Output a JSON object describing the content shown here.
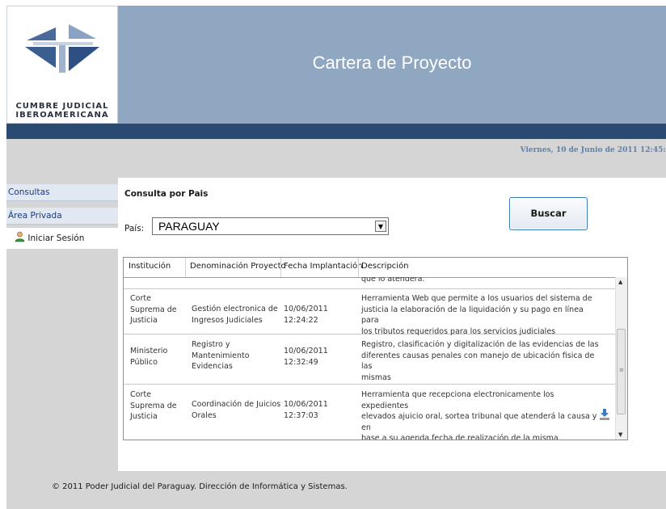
{
  "logo": {
    "line1": "CUMBRE JUDICIAL",
    "line2": "IBEROAMERICANA",
    "icon": "cumbre-judicial-logo-icon"
  },
  "header": {
    "title": "Cartera de Proyecto"
  },
  "date_text": "Viernes, 10 de Junio de 2011 12:45:4",
  "sidebar": {
    "items": [
      {
        "label": "Consultas"
      },
      {
        "label": "Área Privada"
      },
      {
        "label": "Iniciar Sesión",
        "icon": "user-icon"
      }
    ]
  },
  "main": {
    "section_title": "Consulta por Pais",
    "pais_label": "País:",
    "pais_value": "PARAGUAY",
    "buscar_label": "Buscar"
  },
  "grid": {
    "columns": [
      "Institución",
      "Denominación Proyecto",
      "Fecha Implantación",
      "Descripción"
    ],
    "partial_desc": "que lo atenderá.",
    "rows": [
      {
        "institucion": [
          "Corte",
          "Suprema de",
          "Justicia"
        ],
        "denominacion": [
          "Gestión electronica de",
          "Ingresos Judiciales"
        ],
        "fecha": [
          "10/06/2011",
          "12:24:22"
        ],
        "descripcion": [
          "Herramienta Web que permite a los usuarios del sistema de",
          "justicia la elaboración de la liquidación y su pago en línea para",
          "los tributos requeridos para los servicios judiciales"
        ]
      },
      {
        "institucion": [
          "Ministerio",
          "Público"
        ],
        "denominacion": [
          "Registro y",
          "Mantenimiento",
          "Evidencias"
        ],
        "fecha": [
          "10/06/2011",
          "12:32:49"
        ],
        "descripcion": [
          "Registro, clasificación y digitalización de las evidencias de las",
          "diferentes causas penales con manejo de ubicación fisica de las",
          "mismas"
        ]
      },
      {
        "institucion": [
          "Corte",
          "Suprema de",
          "Justicia"
        ],
        "denominacion": [
          "Coordinación de Juicios",
          "Orales"
        ],
        "fecha": [
          "10/06/2011",
          "12:37:03"
        ],
        "descripcion": [
          "Herramienta que recepciona electronicamente los expedientes",
          "elevados ajuicio oral, sortea tribunal que atenderá la causa y en",
          "base a su agenda fecha de realización de la misma"
        ]
      }
    ]
  },
  "footer": {
    "text": "© 2011 Poder Judicial del Paraguay. Dirección de Informática y Sistemas."
  },
  "colors": {
    "header_bg": "#90a7c2",
    "dark_bar": "#2a4a71",
    "date_text": "#5e82b0",
    "sidebar_link": "#1a3a7a",
    "button_border": "#3d7ab8"
  }
}
